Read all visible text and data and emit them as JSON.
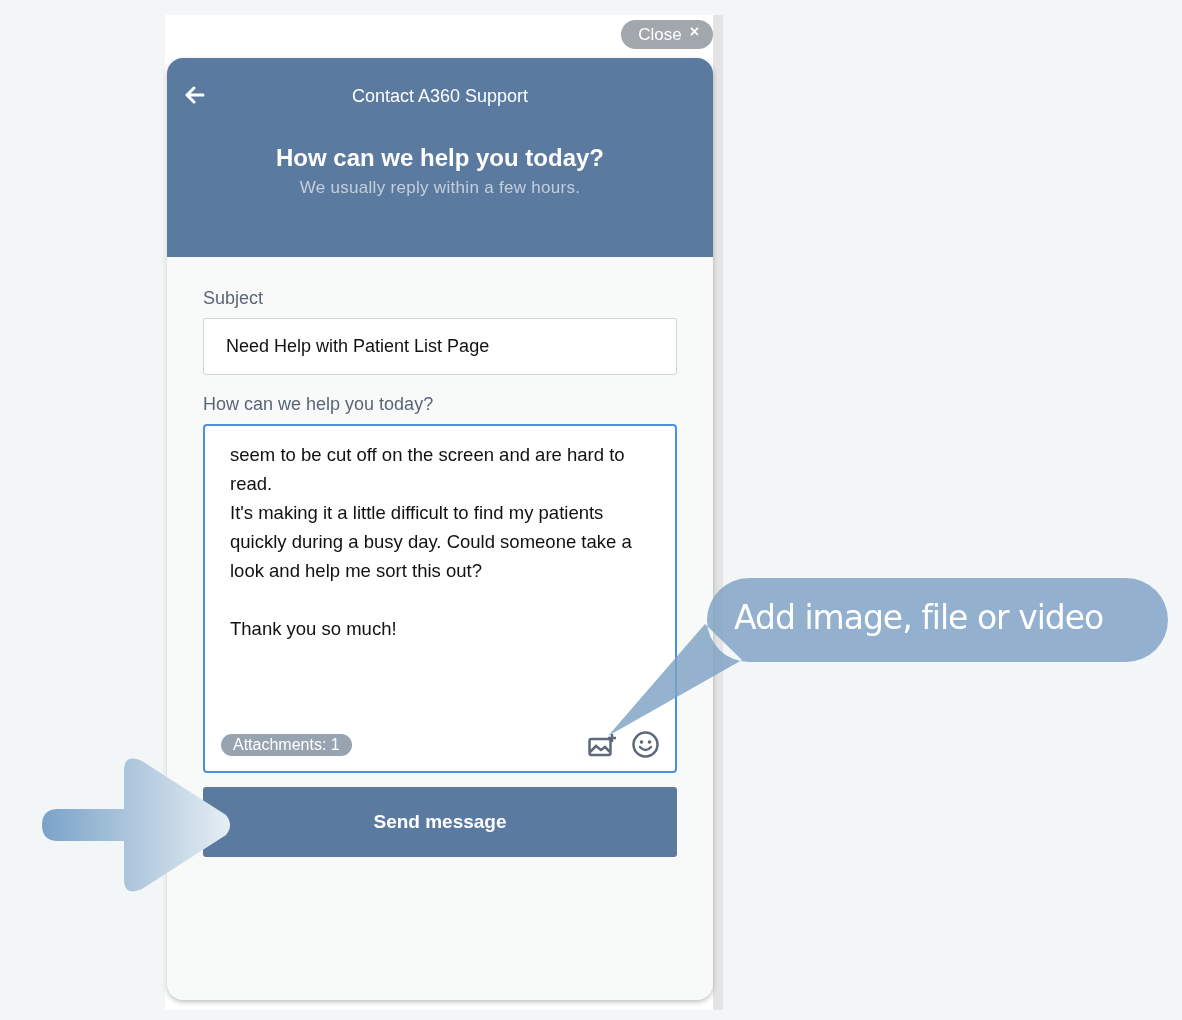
{
  "close_button": {
    "label": "Close",
    "icon": "×"
  },
  "header": {
    "title": "Contact A360 Support",
    "heading": "How can we help you today?",
    "subtitle": "We usually reply within a few hours."
  },
  "form": {
    "subject": {
      "label": "Subject",
      "value": "Need Help with Patient List Page"
    },
    "message": {
      "label": "How can we help you today?",
      "value": "seem to be cut off on the screen and are hard to read.\nIt's making it a little difficult to find my patients quickly during a busy day. Could someone take a look and help me sort this out?\n\nThank you so much!",
      "focused": true
    },
    "attachments": "Attachments: 1",
    "send_button": "Send message"
  },
  "annotations": [
    {
      "kind": "callout",
      "text": "Add image, file or video"
    },
    {
      "kind": "arrow"
    }
  ]
}
